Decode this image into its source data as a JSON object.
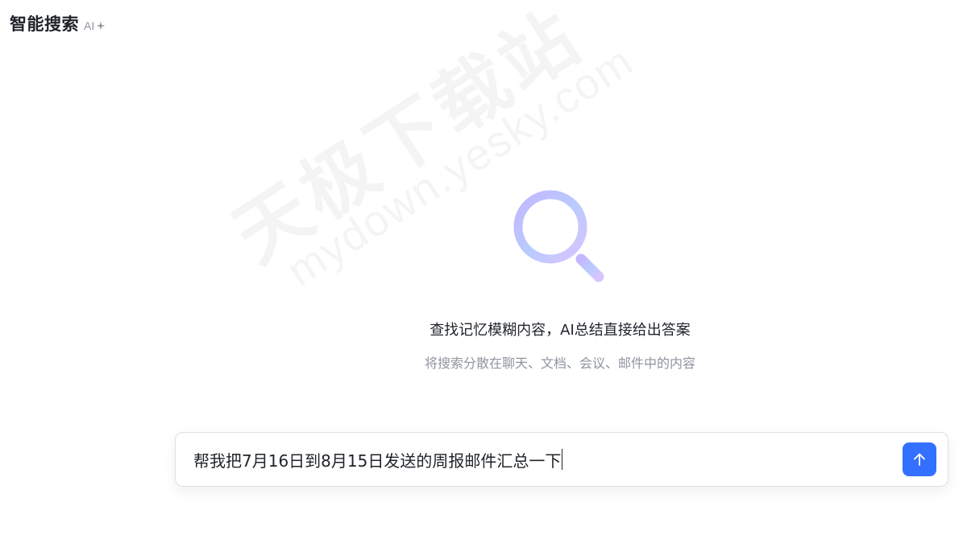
{
  "header": {
    "title": "智能搜索",
    "badge": "AI",
    "badge_icon": "sparkle-icon"
  },
  "watermark": {
    "cn": "天极下载站",
    "en": "mydown.yesky.com"
  },
  "empty_state": {
    "icon": "magnifier-icon",
    "heading": "查找记忆模糊内容，AI总结直接给出答案",
    "subheading": "将搜索分散在聊天、文档、会议、邮件中的内容"
  },
  "search": {
    "value": "帮我把7月16日到8月15日发送的周报邮件汇总一下",
    "send_icon": "arrow-up-icon"
  },
  "colors": {
    "accent": "#3370ff",
    "icon_gradient_start": "#b9c8ff",
    "icon_gradient_end": "#d9c7ff",
    "text_primary": "#1f2329",
    "text_secondary": "#8f959e"
  }
}
